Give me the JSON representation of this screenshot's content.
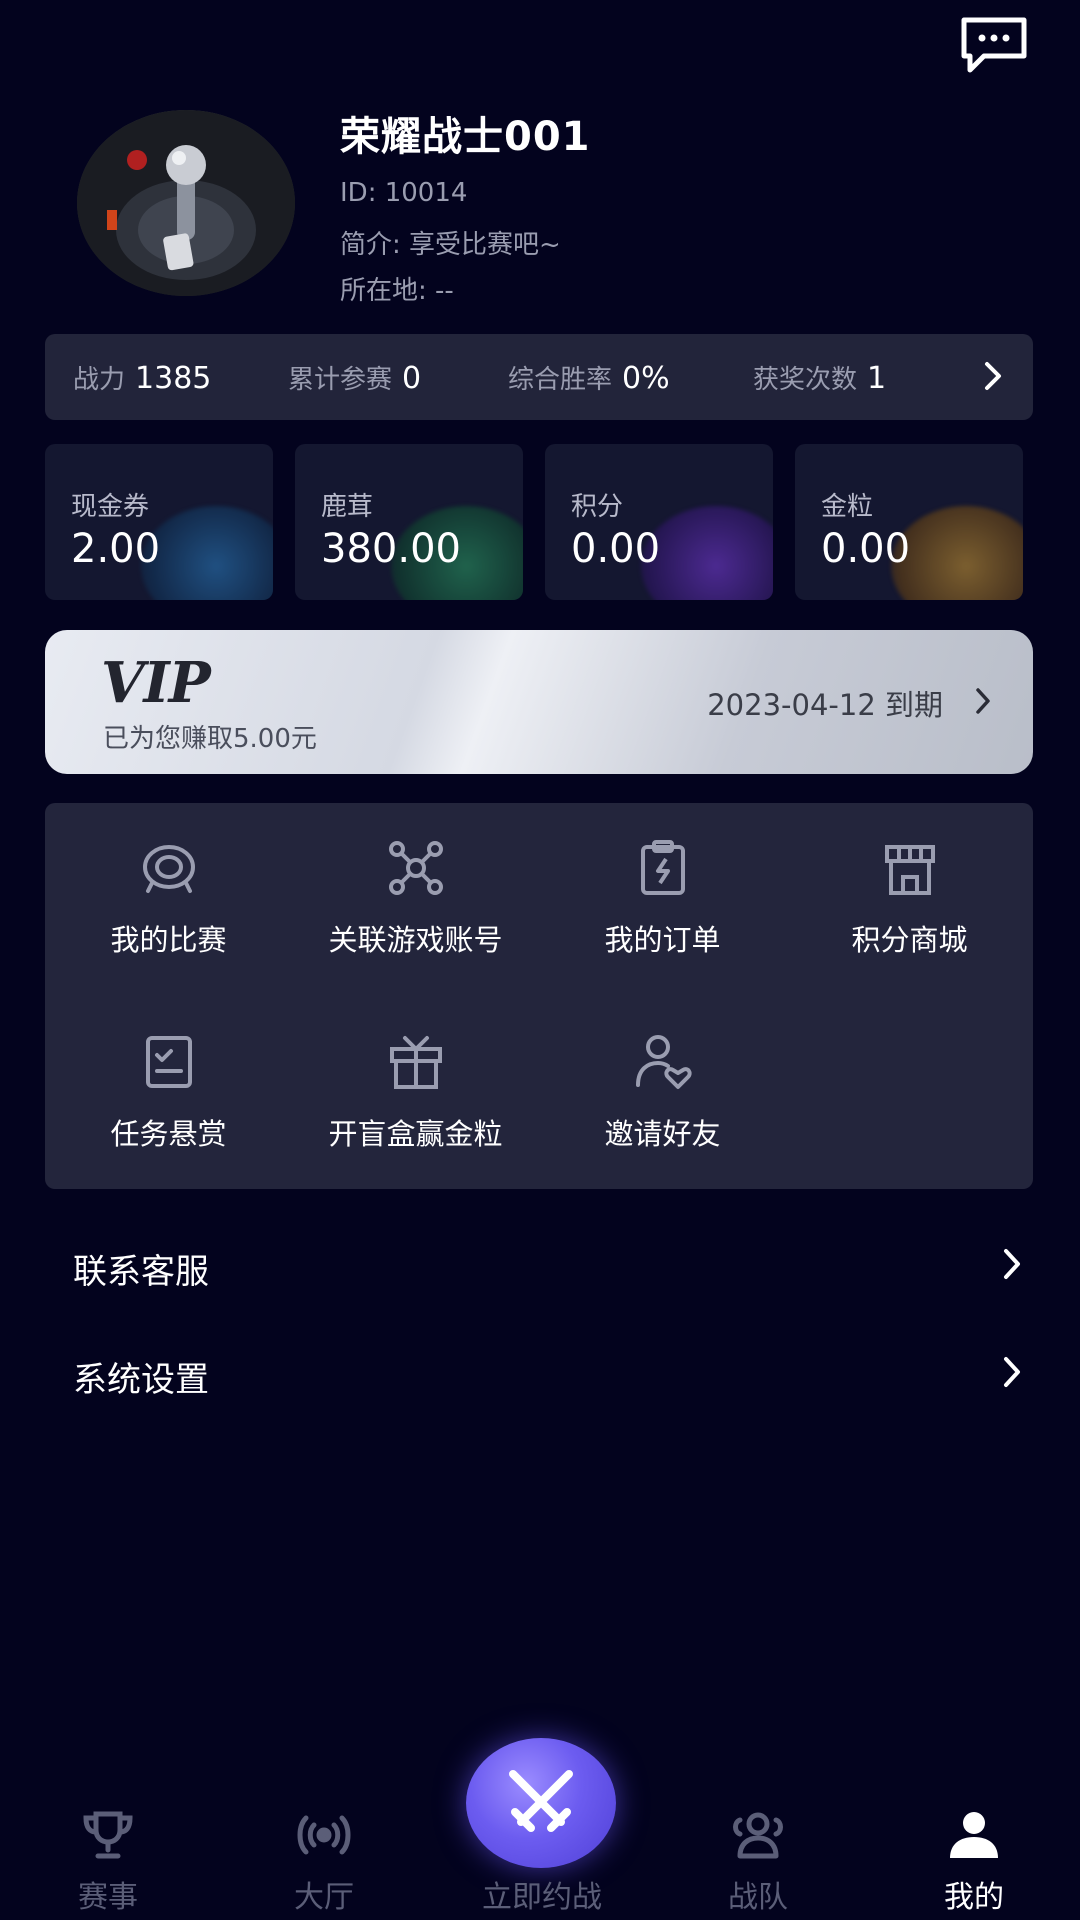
{
  "profile": {
    "name": "荣耀战士001",
    "id_text": "ID: 10014",
    "bio_text": "简介: 享受比赛吧~",
    "location_text": "所在地: --"
  },
  "stats": [
    {
      "label": "战力",
      "value": "1385"
    },
    {
      "label": "累计参赛",
      "value": "0"
    },
    {
      "label": "综合胜率",
      "value": "0%"
    },
    {
      "label": "获奖次数",
      "value": "1"
    }
  ],
  "wallet": [
    {
      "label": "现金券",
      "value": "2.00",
      "accent": "#1f6fb0"
    },
    {
      "label": "鹿茸",
      "value": "380.00",
      "accent": "#1f8f55"
    },
    {
      "label": "积分",
      "value": "0.00",
      "accent": "#6b2fc9"
    },
    {
      "label": "金粒",
      "value": "0.00",
      "accent": "#b07a1a"
    }
  ],
  "vip": {
    "title": "VIP",
    "subtitle": "已为您赚取5.00元",
    "expiry": "2023-04-12 到期"
  },
  "functions": [
    {
      "label": "我的比赛",
      "icon": "target-icon"
    },
    {
      "label": "关联游戏账号",
      "icon": "network-icon"
    },
    {
      "label": "我的订单",
      "icon": "clipboard-icon"
    },
    {
      "label": "积分商城",
      "icon": "store-icon"
    },
    {
      "label": "任务悬赏",
      "icon": "checklist-icon"
    },
    {
      "label": "开盲盒赢金粒",
      "icon": "gift-icon"
    },
    {
      "label": "邀请好友",
      "icon": "user-heart-icon"
    }
  ],
  "menu": {
    "support": "联系客服",
    "settings": "系统设置"
  },
  "tabs": {
    "events": "赛事",
    "lobby": "大厅",
    "battle": "立即约战",
    "team": "战队",
    "me": "我的"
  },
  "colors": {
    "background": "#03031e",
    "panel": "#23253c",
    "battle_button": "#6c5cf0"
  }
}
